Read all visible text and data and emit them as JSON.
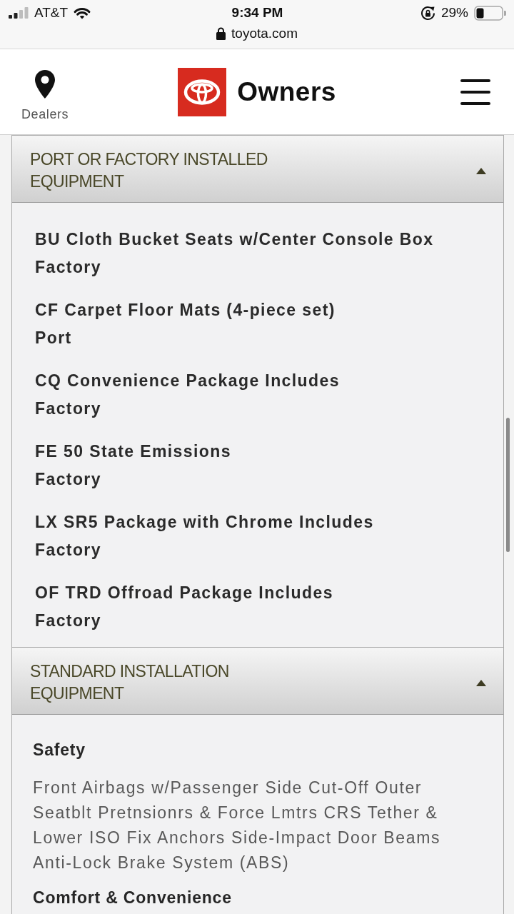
{
  "status_bar": {
    "carrier": "AT&T",
    "time": "9:34 PM",
    "battery": "29%",
    "url": "toyota.com"
  },
  "header": {
    "dealers_label": "Dealers",
    "brand": "Owners"
  },
  "sections": [
    {
      "title": "PORT OR FACTORY INSTALLED EQUIPMENT",
      "expanded": true,
      "items": [
        {
          "name": "BU Cloth Bucket Seats w/Center Console Box",
          "source": "Factory"
        },
        {
          "name": "CF Carpet Floor Mats (4-piece set)",
          "source": "Port"
        },
        {
          "name": "CQ Convenience Package Includes",
          "source": "Factory"
        },
        {
          "name": "FE 50 State Emissions",
          "source": "Factory"
        },
        {
          "name": "LX SR5 Package with Chrome Includes",
          "source": "Factory"
        },
        {
          "name": "OF TRD Offroad Package Includes",
          "source": "Factory"
        }
      ]
    },
    {
      "title": "STANDARD INSTALLATION EQUIPMENT",
      "expanded": true,
      "groups": [
        {
          "heading": "Safety",
          "text": "Front Airbags w/Passenger Side Cut-Off Outer Seatblt Pretnsionrs & Force Lmtrs CRS Tether & Lower ISO Fix Anchors Side-Impact Door Beams Anti-Lock Brake System (ABS)"
        },
        {
          "heading": "Comfort & Convenience"
        }
      ]
    }
  ]
}
